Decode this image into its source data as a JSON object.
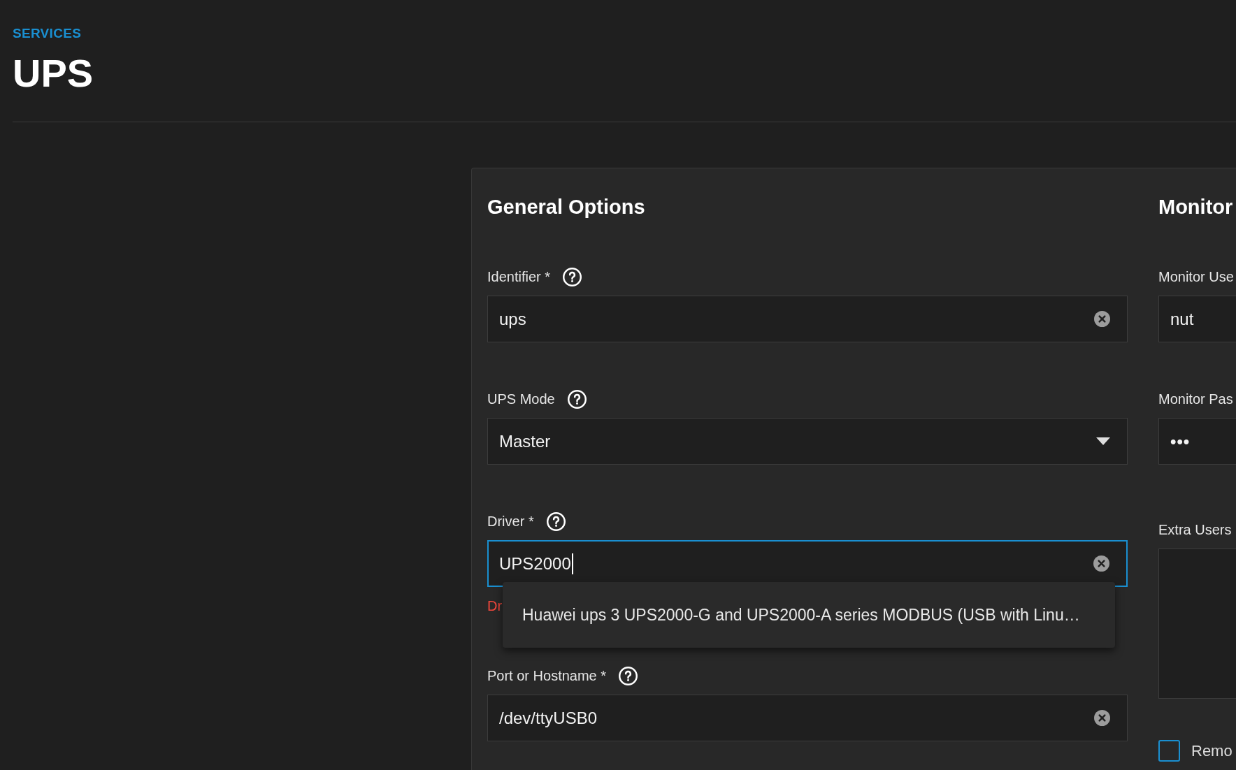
{
  "breadcrumb": "SERVICES",
  "page_title": "UPS",
  "sections": [
    {
      "title": "General Options",
      "fields": [
        {
          "kind": "text",
          "label": "Identifier *",
          "help": true,
          "value": "ups",
          "clearable": true,
          "focused": false
        },
        {
          "kind": "select",
          "label": "UPS Mode",
          "help": true,
          "value": "Master",
          "clearable": false,
          "focused": false
        },
        {
          "kind": "text",
          "label": "Driver *",
          "help": true,
          "value": "UPS2000",
          "clearable": true,
          "focused": true,
          "error": "Dr",
          "suggestions": [
            {
              "label": "Huawei ups 3 UPS2000-G and UPS2000-A series MODBUS (USB with Linu…",
              "selected": false
            }
          ]
        },
        {
          "kind": "text",
          "label": "Port or Hostname *",
          "help": true,
          "value": "/dev/ttyUSB0",
          "clearable": true,
          "focused": false
        }
      ]
    },
    {
      "title": "Monitor",
      "fields": [
        {
          "kind": "text",
          "label": "Monitor Use",
          "help": false,
          "value": "nut",
          "clearable": false,
          "focused": false
        },
        {
          "kind": "password",
          "label": "Monitor Pas",
          "help": false,
          "value": "•••",
          "clearable": false,
          "focused": false
        },
        {
          "kind": "textarea",
          "label": "Extra Users",
          "help": false,
          "clearable": false,
          "focused": false
        },
        {
          "kind": "checkbox",
          "label": "Remo",
          "checked": false
        }
      ]
    }
  ]
}
